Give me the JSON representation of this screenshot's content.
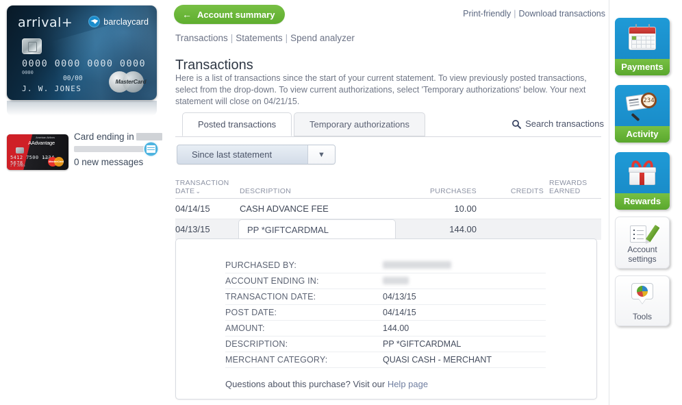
{
  "left": {
    "hero_card": {
      "brand": "arrival+",
      "bank": "barclaycard",
      "number": "0000 0000 0000 0000",
      "minor_number": "0000",
      "expiry": "00/00",
      "holder": "J. W. JONES",
      "network": "MasterCard"
    },
    "second_card": {
      "program": "AAdvantage",
      "issuer_tag": "American Airlines",
      "number": "5412 7500 1234 5678",
      "tier": "WORLD",
      "holder": "J W JONES",
      "network": "MasterCard",
      "aviator_tag": "AVIATOR"
    },
    "card_ending_label": "Card ending in",
    "card_ending_value_redacted": true,
    "messages_label": "0 new messages",
    "message_icon": "messages-icon"
  },
  "main": {
    "back_button": {
      "label": "Account summary",
      "icon": "arrow-left-icon"
    },
    "top_links": [
      {
        "label": "Print-friendly"
      },
      {
        "label": "Download transactions"
      }
    ],
    "top_links_separator": "|",
    "breadcrumb_nav": [
      {
        "label": "Transactions"
      },
      {
        "label": "Statements"
      },
      {
        "label": "Spend analyzer"
      }
    ],
    "breadcrumb_separator": "|",
    "page_title": "Transactions",
    "page_intro": "Here is a list of transactions since the start of your current statement. To view previously posted transactions, select from the drop-down. To view current authorizations, select 'Temporary authorizations' below. Your next statement will close on 04/21/15.",
    "tabs": [
      {
        "label": "Posted transactions",
        "active": true
      },
      {
        "label": "Temporary authorizations",
        "active": false
      }
    ],
    "search_link": {
      "label": "Search transactions",
      "icon": "search-icon"
    },
    "period_dropdown": {
      "value": "Since last statement",
      "icon": "chevron-down-icon"
    },
    "table": {
      "headers": {
        "date_line1": "TRANSACTION",
        "date_line2": "DATE",
        "description": "DESCRIPTION",
        "purchases": "PURCHASES",
        "credits": "CREDITS",
        "rewards_line1": "REWARDS",
        "rewards_line2": "EARNED"
      },
      "sort_indicator": "⌄",
      "rows": [
        {
          "date": "04/14/15",
          "description": "CASH ADVANCE FEE",
          "purchases": "10.00",
          "credits": "",
          "rewards": "",
          "selected": false
        },
        {
          "date": "04/13/15",
          "description": "PP *GIFTCARDMAL",
          "purchases": "144.00",
          "credits": "",
          "rewards": "",
          "selected": true
        }
      ]
    },
    "detail": {
      "rows": [
        {
          "label": "PURCHASED BY:",
          "value": "",
          "redacted": true,
          "redact_width": "name"
        },
        {
          "label": "ACCOUNT ENDING IN:",
          "value": "",
          "redacted": true,
          "redact_width": "acct"
        },
        {
          "label": "TRANSACTION DATE:",
          "value": "04/13/15",
          "redacted": false
        },
        {
          "label": "POST DATE:",
          "value": "04/14/15",
          "redacted": false
        },
        {
          "label": "AMOUNT:",
          "value": "144.00",
          "redacted": false
        },
        {
          "label": "DESCRIPTION:",
          "value": "PP *GIFTCARDMAL",
          "redacted": false
        },
        {
          "label": "MERCHANT CATEGORY:",
          "value": "QUASI CASH - MERCHANT",
          "redacted": false
        }
      ],
      "help_text": "Questions about this purchase? Visit our",
      "help_link": "Help page"
    }
  },
  "rail": {
    "tiles": [
      {
        "label": "Payments",
        "icon": "calendar-icon",
        "style": "blue"
      },
      {
        "label": "Activity",
        "icon": "statement-magnifier-icon",
        "style": "blue"
      },
      {
        "label": "Rewards",
        "icon": "gift-icon",
        "style": "blue"
      },
      {
        "label": "Account\nsettings",
        "label_line1": "Account",
        "label_line2": "settings",
        "icon": "note-pencil-icon",
        "style": "white"
      },
      {
        "label": "Tools",
        "icon": "pie-chart-bubble-icon",
        "style": "white"
      }
    ]
  },
  "colors": {
    "green_accent": "#5faE2f",
    "blue_tile": "#1f9ad6",
    "link_text": "#5b6780",
    "body_text": "#3f4757",
    "muted_text": "#8d93a4"
  }
}
